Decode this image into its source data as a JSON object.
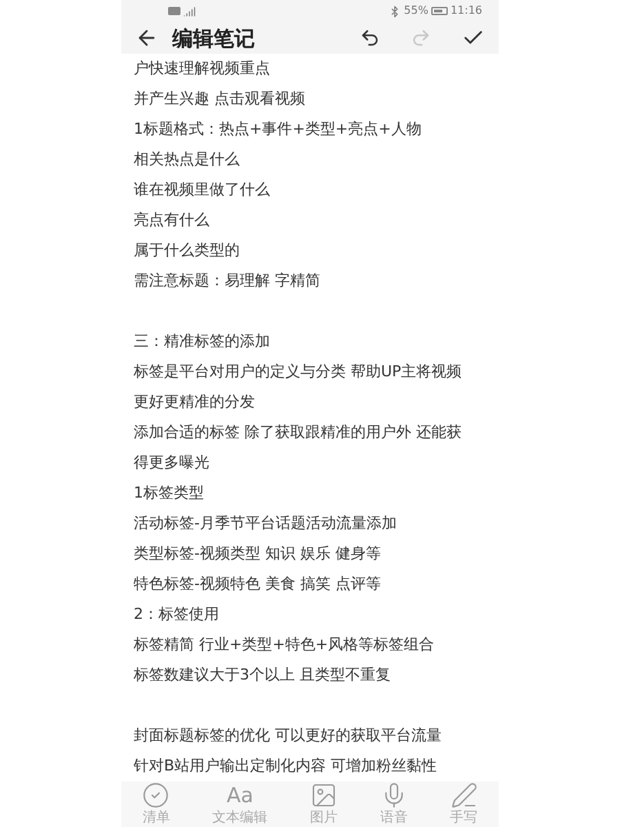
{
  "status_bar": {
    "battery": "55%",
    "time": "11:16"
  },
  "header": {
    "title": "编辑笔记",
    "undo": {
      "disabled": false
    },
    "redo": {
      "disabled": true
    }
  },
  "note": {
    "paragraphs": [
      [
        "户快速理解视频重点",
        "并产生兴趣 点击观看视频",
        "1标题格式：热点+事件+类型+亮点+人物",
        "相关热点是什么",
        "谁在视频里做了什么",
        "亮点有什么",
        "属于什么类型的",
        "需注意标题：易理解 字精简"
      ],
      [
        "三：精准标签的添加",
        "标签是平台对用户的定义与分类 帮助UP主将视频",
        "更好更精准的分发",
        "添加合适的标签 除了获取跟精准的用户外 还能获",
        "得更多曝光",
        "1标签类型",
        "活动标签-月季节平台话题活动流量添加",
        "类型标签-视频类型 知识 娱乐 健身等",
        "特色标签-视频特色 美食 搞笑 点评等",
        "2：标签使用",
        "标签精简 行业+类型+特色+风格等标签组合",
        "标签数建议大于3个以上 且类型不重复"
      ],
      [
        "封面标题标签的优化 可以更好的获取平台流量",
        "针对B站用户输出定制化内容 可增加粉丝黏性"
      ]
    ]
  },
  "toolbar": [
    {
      "kind": "checklist",
      "label": "清单"
    },
    {
      "kind": "text",
      "glyph": "Aa",
      "label": "文本编辑"
    },
    {
      "kind": "image",
      "label": "图片"
    },
    {
      "kind": "voice",
      "label": "语音"
    },
    {
      "kind": "handwriting",
      "label": "手写"
    }
  ]
}
